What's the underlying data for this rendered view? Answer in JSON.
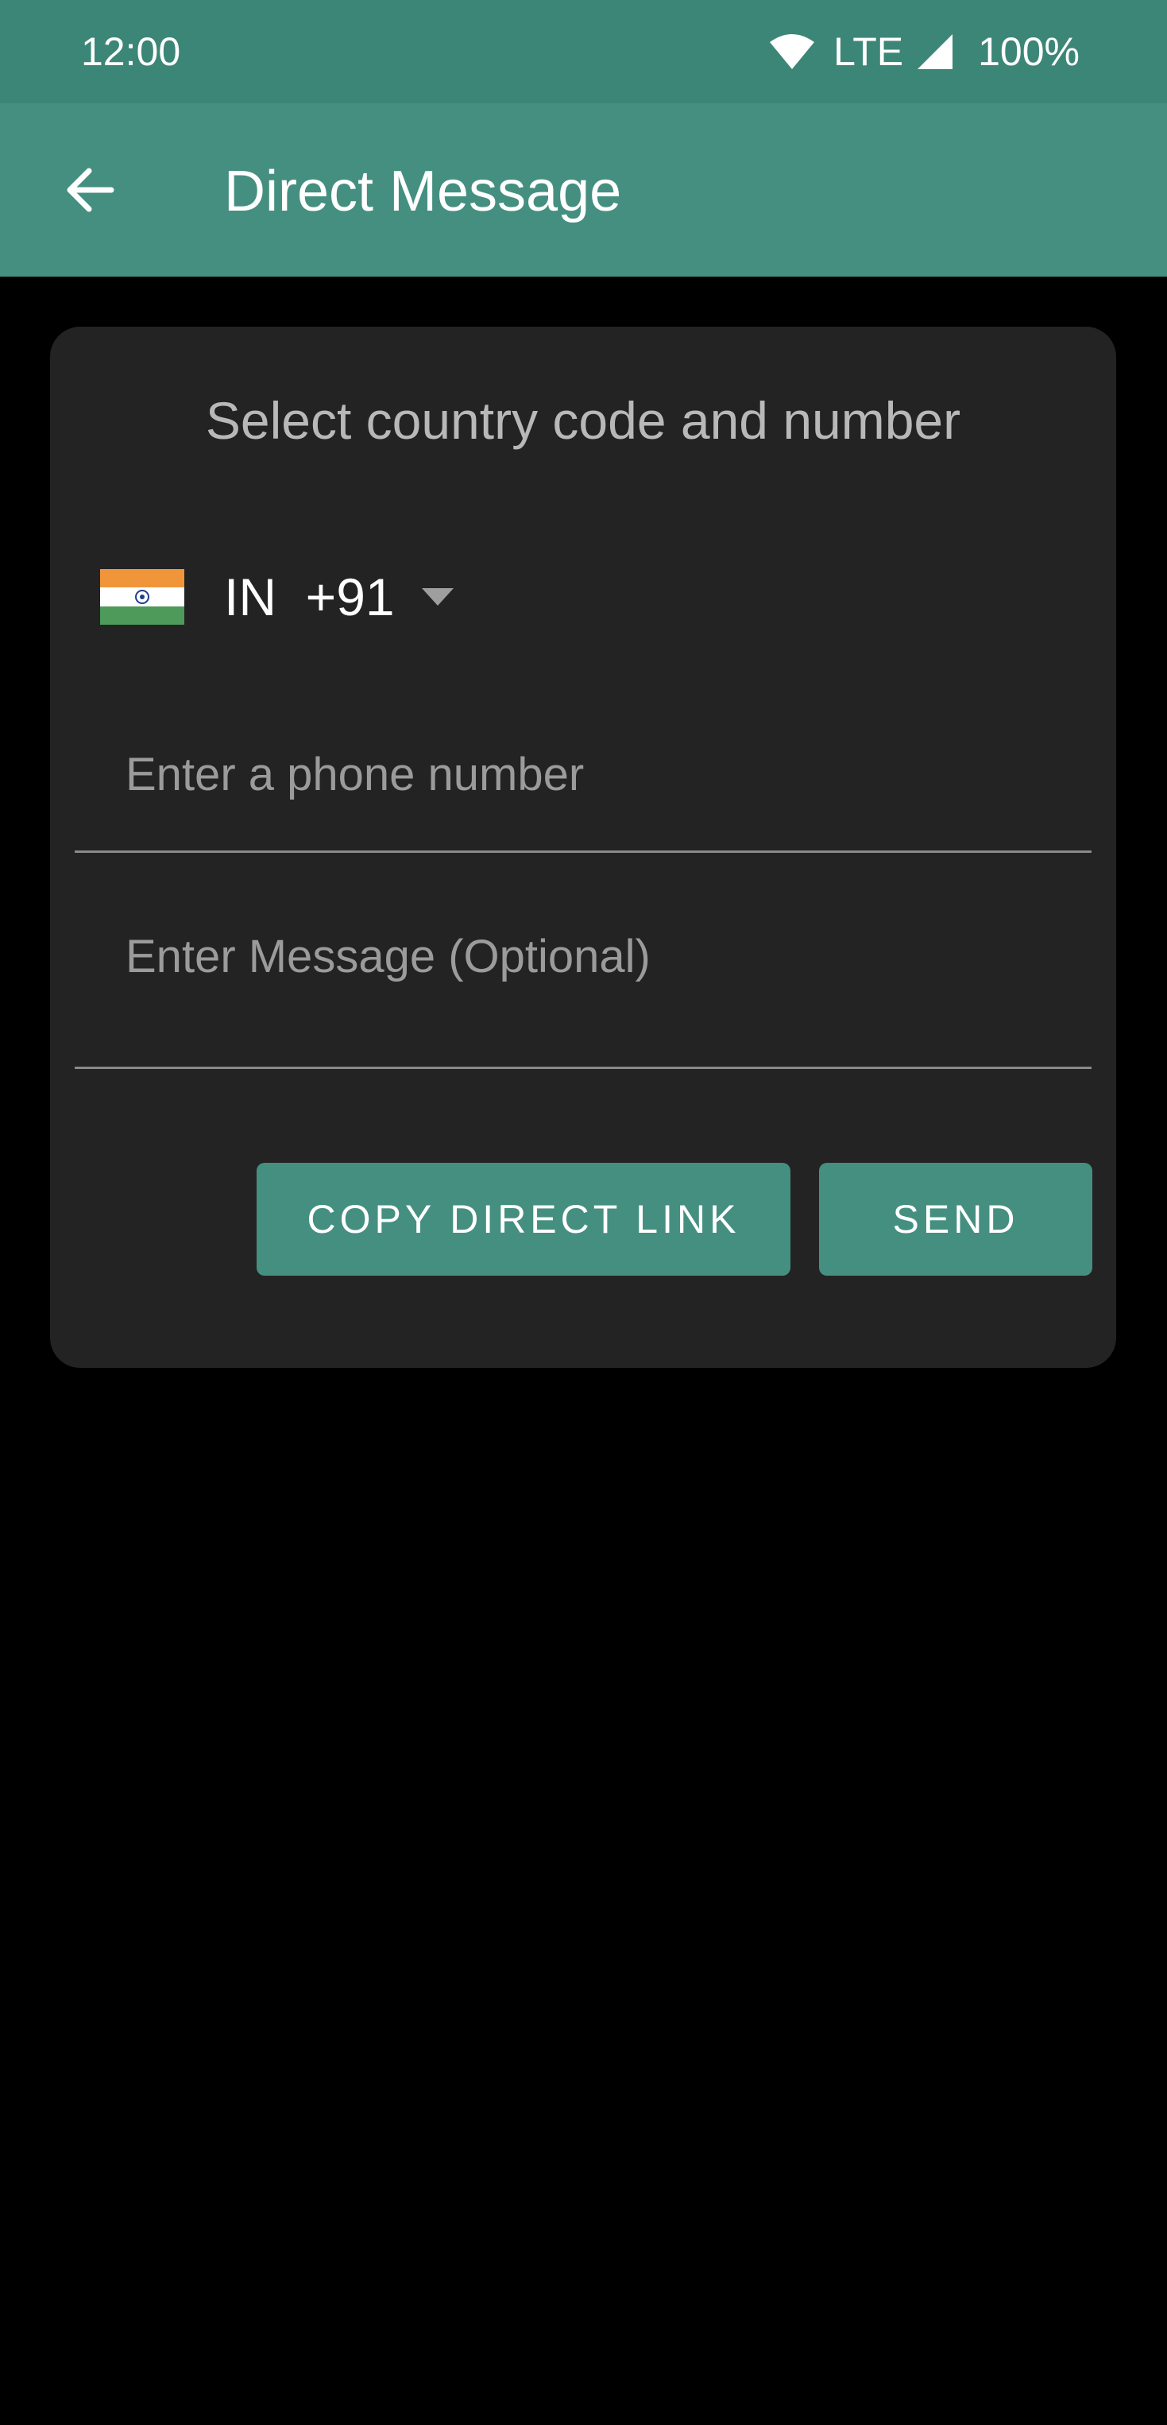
{
  "status_bar": {
    "time": "12:00",
    "network": "LTE",
    "battery": "100%"
  },
  "app_bar": {
    "title": "Direct Message",
    "back_icon": "arrow-back-icon"
  },
  "form": {
    "heading": "Select country code and number",
    "country": {
      "iso": "IN",
      "dial_code": "+91",
      "flag_icon": "india-flag-icon",
      "selected_label": "IN  +91"
    },
    "phone_input": {
      "value": "",
      "placeholder": "Enter a phone number"
    },
    "message_input": {
      "value": "",
      "placeholder": "Enter Message (Optional)"
    },
    "copy_link_label": "COPY DIRECT LINK",
    "send_label": "SEND"
  },
  "colors": {
    "status_bar": "#3c8677",
    "app_bar": "#458f81",
    "accent": "#458f81",
    "card": "#232323",
    "background": "#000000"
  }
}
